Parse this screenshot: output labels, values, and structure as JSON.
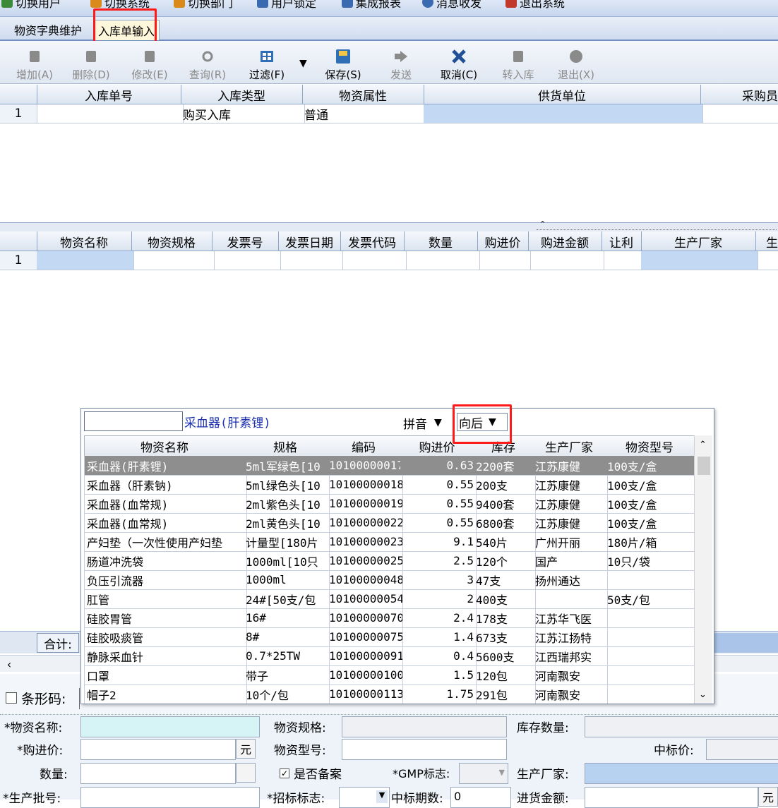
{
  "top_menu": {
    "items": [
      {
        "label": "切换用户",
        "icon": "user-switch-icon",
        "color": "#3a8a3a"
      },
      {
        "label": "切换系统",
        "icon": "system-switch-icon",
        "color": "#d98a1a"
      },
      {
        "label": "切换部门",
        "icon": "department-switch-icon",
        "color": "#d98a1a"
      },
      {
        "label": "用户锁定",
        "icon": "lock-icon",
        "color": "#3a6ab0"
      },
      {
        "label": "集成报表",
        "icon": "report-icon",
        "color": "#3a6ab0"
      },
      {
        "label": "消息收发",
        "icon": "message-icon",
        "color": "#3a6ab0"
      },
      {
        "label": "退出系统",
        "icon": "exit-icon",
        "color": "#c0392b"
      }
    ]
  },
  "tabs": [
    {
      "label": "物资字典维护",
      "active": false
    },
    {
      "label": "入库单输入",
      "active": true
    }
  ],
  "toolbar": {
    "buttons": [
      {
        "label": "增加(A)",
        "icon": "add-icon",
        "enabled": false
      },
      {
        "label": "删除(D)",
        "icon": "delete-icon",
        "enabled": false
      },
      {
        "label": "修改(E)",
        "icon": "edit-icon",
        "enabled": false
      },
      {
        "label": "查询(R)",
        "icon": "query-icon",
        "enabled": false
      },
      {
        "label": "过滤(F)",
        "icon": "filter-icon",
        "enabled": true
      },
      {
        "label": "保存(S)",
        "icon": "save-icon",
        "enabled": true
      },
      {
        "label": "发送",
        "icon": "send-icon",
        "enabled": false
      },
      {
        "label": "取消(C)",
        "icon": "cancel-icon",
        "enabled": true
      },
      {
        "label": "转入库",
        "icon": "transfer-icon",
        "enabled": false
      },
      {
        "label": "退出(X)",
        "icon": "exit-icon",
        "enabled": false
      }
    ]
  },
  "master_grid": {
    "columns": [
      "入库单号",
      "入库类型",
      "物资属性",
      "供货单位",
      "采购员"
    ],
    "rows": [
      {
        "no": "1",
        "cells": [
          "",
          "购买入库",
          "普通",
          "",
          ""
        ]
      }
    ]
  },
  "detail_grid": {
    "columns": [
      "物资名称",
      "物资规格",
      "发票号",
      "发票日期",
      "发票代码",
      "数量",
      "购进价",
      "购进金额",
      "让利",
      "生产厂家",
      "生"
    ],
    "rows": [
      {
        "no": "1"
      }
    ],
    "total_label": "合计:"
  },
  "popup": {
    "search_value": "",
    "query_text": "采血器(肝素锂)",
    "mode_value": "拼音",
    "direction_value": "向后",
    "columns": [
      "物资名称",
      "规格",
      "编码",
      "购进价",
      "库存",
      "生产厂家",
      "物资型号"
    ],
    "rows": [
      [
        "采血器(肝素锂)",
        "5ml军绿色[10",
        "10100000017",
        "0.63",
        "2200套",
        "江苏康健",
        "100支/盒"
      ],
      [
        "采血器（肝素钠)",
        "5ml绿色头[10",
        "10100000018",
        "0.55",
        "200支",
        "江苏康健",
        "100支/盒"
      ],
      [
        "采血器(血常规)",
        "2ml紫色头[10",
        "10100000019",
        "0.55",
        "9400套",
        "江苏康健",
        "100支/盒"
      ],
      [
        "采血器(血常规)",
        "2ml黄色头[10",
        "10100000022",
        "0.55",
        "6800套",
        "江苏康健",
        "100支/盒"
      ],
      [
        "产妇垫（一次性使用产妇垫",
        "计量型[180片",
        "10100000023",
        "9.1",
        "540片",
        "广州开丽",
        "180片/箱"
      ],
      [
        "肠道冲洗袋",
        "1000ml[10只",
        "10100000025",
        "2.5",
        "120个",
        "国产",
        "10只/袋"
      ],
      [
        "负压引流器",
        "1000ml",
        "10100000048",
        "3",
        "47支",
        "扬州通达",
        ""
      ],
      [
        "肛管",
        "24#[50支/包",
        "10100000054",
        "2",
        "400支",
        "",
        "50支/包"
      ],
      [
        "硅胶胃管",
        "16#",
        "10100000070",
        "2.4",
        "178支",
        "江苏华飞医",
        ""
      ],
      [
        "硅胶吸痰管",
        "8#",
        "10100000075",
        "1.4",
        "673支",
        "江苏江扬特",
        ""
      ],
      [
        "静脉采血针",
        "0.7*25TW",
        "10100000091",
        "0.4",
        "5600支",
        "江西瑞邦实",
        ""
      ],
      [
        "口罩",
        "带子",
        "10100000100",
        "1.5",
        "120包",
        "河南飘安",
        ""
      ],
      [
        "帽子2",
        "10个/包",
        "10100000113",
        "1.75",
        "291包",
        "河南飘安",
        ""
      ]
    ]
  },
  "form": {
    "barcode_label": "条形码:",
    "material_name_label": "*物资名称:",
    "material_spec_label": "物资规格:",
    "stock_qty_label": "库存数量:",
    "purchase_price_label": "*购进价:",
    "yuan_unit": "元",
    "material_model_label": "物资型号:",
    "bid_price_label": "中标价:",
    "quantity_label": "数量:",
    "filed_label": "是否备案",
    "gmp_label": "*GMP标志:",
    "manufacturer_label": "生产厂家:",
    "batch_label": "*生产批号:",
    "bid_flag_label": "*招标标志:",
    "bid_period_label": "中标期数:",
    "bid_period_value": "0",
    "amount_label": "进货金额:",
    "amount_unit": "元"
  },
  "colors": {
    "highlight_box": "#ff1a1a",
    "selected_row": "#8e8e8e",
    "cell_highlight": "#c3d8f3",
    "name_field_fill": "#d6f3f5"
  }
}
